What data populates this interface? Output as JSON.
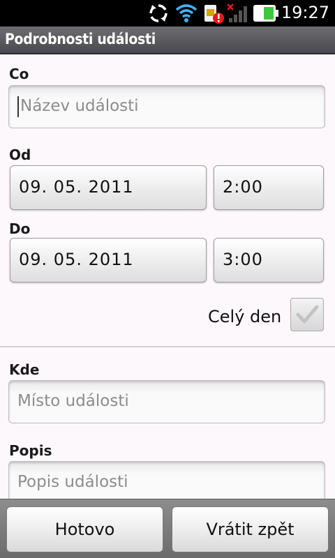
{
  "status_bar": {
    "time": "19:27",
    "icons": [
      "sync-icon",
      "wifi-icon",
      "sim-alert-icon",
      "signal-icon",
      "battery-icon"
    ]
  },
  "header": {
    "title": "Podrobnosti události"
  },
  "form": {
    "what": {
      "label": "Co",
      "placeholder": "Název události",
      "value": ""
    },
    "from": {
      "label": "Od",
      "date": "09. 05. 2011",
      "time": "2:00"
    },
    "to": {
      "label": "Do",
      "date": "09. 05. 2011",
      "time": "3:00"
    },
    "all_day": {
      "label": "Celý den",
      "checked": false
    },
    "where": {
      "label": "Kde",
      "placeholder": "Místo události",
      "value": ""
    },
    "description": {
      "label": "Popis",
      "placeholder": "Popis události",
      "value": ""
    }
  },
  "actions": {
    "done": "Hotovo",
    "revert": "Vrátit zpět"
  },
  "colors": {
    "title_bar": "#5b5b5f",
    "background": "#fdf8fc",
    "bottom_bar": "#7a7a7a"
  }
}
